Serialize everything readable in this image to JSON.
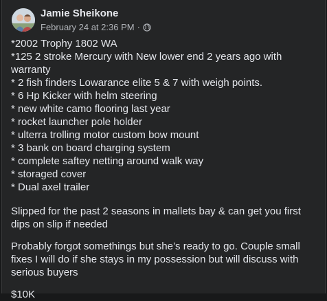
{
  "post": {
    "author": "Jamie Sheikone",
    "date": "February 24 at 2:36 PM",
    "separator": "·",
    "privacy_icon": "globe-icon",
    "avatar_icon": "profile-photo",
    "lines": [
      "*2002 Trophy 1802 WA",
      "*125 2 stroke Mercury with New lower end 2 years ago with warranty",
      "* 2 fish finders Lowarance elite 5 & 7 with weigh points.",
      "* 6 Hp Kicker with helm steering",
      "* new white camo flooring last year",
      "* rocket launcher pole holder",
      "* ulterra trolling motor custom bow mount",
      "* 3 bank on board charging system",
      "* complete saftey netting around walk way",
      "* storaged cover",
      "* Dual axel trailer"
    ],
    "paragraph_1": "Slipped for the past 2 seasons in mallets bay & can get you first dips on slip if needed",
    "paragraph_2": "Probably forgot somethings but she’s ready to go. Couple small fixes I will do if she stays in my possession but will discuss with serious buyers",
    "price": "$10K"
  },
  "colors": {
    "background": "#242526",
    "text_primary": "#e4e6eb",
    "text_secondary": "#b0b3b8"
  }
}
